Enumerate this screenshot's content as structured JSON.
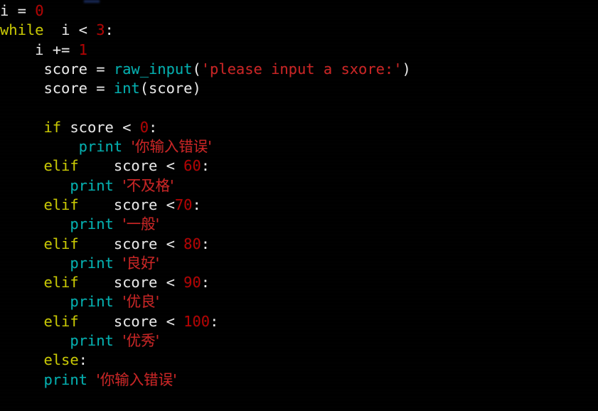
{
  "editor": {
    "language": "python",
    "background_color": "#000000",
    "default_text_color": "#e8e8e8",
    "palette": {
      "keyword": "#c8c800",
      "builtin_function": "#00b0b0",
      "number": "#b40000",
      "string": "#cc2222",
      "identifier": "#e8e8e8"
    }
  },
  "code": {
    "line_01": {
      "id": "i",
      "op": " = ",
      "num": "0"
    },
    "line_02": {
      "kw": "while",
      "gap": "  ",
      "id": "i",
      "op": " < ",
      "num": "3",
      "colon": ":"
    },
    "line_03": {
      "indent": "    ",
      "id": "i",
      "op": " += ",
      "num": "1"
    },
    "line_04": {
      "indent": "     ",
      "id": "score",
      "op": " = ",
      "fn": "raw_input",
      "paren_open": "(",
      "str": "'please input a sxore:'",
      "paren_close": ")"
    },
    "line_05": {
      "indent": "     ",
      "id": "score",
      "op": " = ",
      "fn": "int",
      "paren_open": "(",
      "arg": "score",
      "paren_close": ")"
    },
    "line_06": {
      "blank": ""
    },
    "line_07": {
      "indent": "     ",
      "kw": "if",
      "gap": " ",
      "id": "score",
      "op": " < ",
      "num": "0",
      "colon": ":"
    },
    "line_08": {
      "indent": "         ",
      "fn": "print",
      "gap": " ",
      "str": "'你输入错误'"
    },
    "line_09": {
      "indent": "     ",
      "kw": "elif",
      "gap": "    ",
      "id": "score",
      "op": " < ",
      "num": "60",
      "colon": ":"
    },
    "line_10": {
      "indent": "        ",
      "fn": "print",
      "gap": " ",
      "str": "'不及格'"
    },
    "line_11": {
      "indent": "     ",
      "kw": "elif",
      "gap": "    ",
      "id": "score",
      "op": " <",
      "num": "70",
      "colon": ":"
    },
    "line_12": {
      "indent": "        ",
      "fn": "print",
      "gap": " ",
      "str": "'一般'"
    },
    "line_13": {
      "indent": "     ",
      "kw": "elif",
      "gap": "    ",
      "id": "score",
      "op": " < ",
      "num": "80",
      "colon": ":"
    },
    "line_14": {
      "indent": "        ",
      "fn": "print",
      "gap": " ",
      "str": "'良好'"
    },
    "line_15": {
      "indent": "     ",
      "kw": "elif",
      "gap": "    ",
      "id": "score",
      "op": " < ",
      "num": "90",
      "colon": ":"
    },
    "line_16": {
      "indent": "        ",
      "fn": "print",
      "gap": " ",
      "str": "'优良'"
    },
    "line_17": {
      "indent": "     ",
      "kw": "elif",
      "gap": "    ",
      "id": "score",
      "op": " < ",
      "num": "100",
      "colon": ":"
    },
    "line_18": {
      "indent": "        ",
      "fn": "print",
      "gap": " ",
      "str": "'优秀'"
    },
    "line_19": {
      "indent": "     ",
      "kw": "else",
      "colon": ":"
    },
    "line_20": {
      "indent": "     ",
      "fn": "print",
      "gap": " ",
      "str": "'你输入错误'"
    }
  }
}
